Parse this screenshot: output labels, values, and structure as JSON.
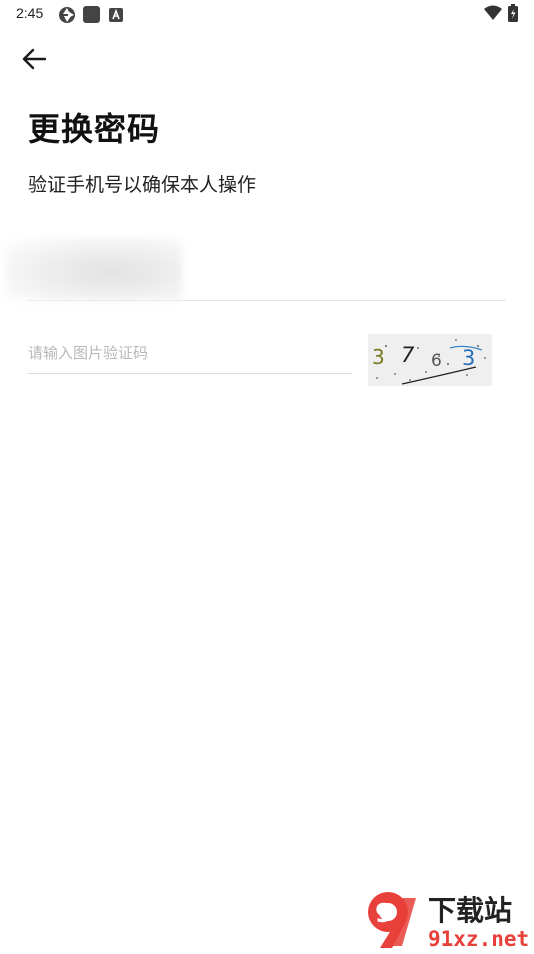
{
  "status_bar": {
    "time": "2:45",
    "icons": [
      "aperture-icon",
      "square-app-icon",
      "a-badge-icon",
      "wifi-icon",
      "battery-icon"
    ]
  },
  "nav": {
    "back_icon": "arrow-left-icon"
  },
  "header": {
    "title": "更换密码",
    "subtitle": "验证手机号以确保本人操作"
  },
  "form": {
    "phone_value": "",
    "captcha_placeholder": "请输入图片验证码",
    "captcha_value": "",
    "captcha_code": [
      "3",
      "7",
      "6",
      "3"
    ],
    "captcha_colors": [
      "#7a7a20",
      "#222222",
      "#555555",
      "#2a6fb8"
    ]
  },
  "watermark": {
    "logo_text": "9",
    "brand": "下载站",
    "domain": "91xz.net",
    "colors": {
      "red": "#e8403a",
      "dark": "#222222"
    }
  }
}
